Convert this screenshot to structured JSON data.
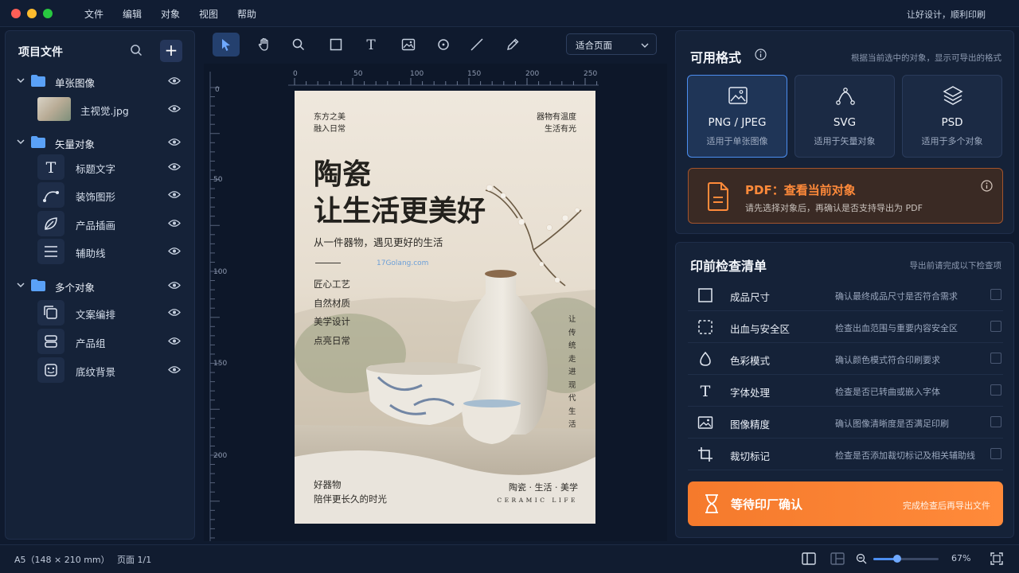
{
  "menubar": {
    "items": [
      "文件",
      "编辑",
      "对象",
      "视图",
      "帮助"
    ],
    "slogan": "让好设计，顺利印刷"
  },
  "left_panel": {
    "title": "项目文件",
    "groups": [
      {
        "label": "单张图像",
        "items": [
          {
            "label": "主视觉.jpg",
            "icon": "image-thumbnail"
          }
        ]
      },
      {
        "label": "矢量对象",
        "items": [
          {
            "label": "标题文字",
            "icon": "text-icon"
          },
          {
            "label": "装饰图形",
            "icon": "bezier-icon"
          },
          {
            "label": "产品插画",
            "icon": "leaf-icon"
          },
          {
            "label": "辅助线",
            "icon": "lines-icon"
          }
        ]
      },
      {
        "label": "多个对象",
        "items": [
          {
            "label": "文案编排",
            "icon": "copy-icon"
          },
          {
            "label": "产品组",
            "icon": "layers-group-icon"
          },
          {
            "label": "底纹背景",
            "icon": "pattern-icon"
          }
        ]
      }
    ]
  },
  "toolbar": {
    "tools": [
      "select-tool",
      "hand-tool",
      "zoom-tool",
      "rectangle-tool",
      "text-tool",
      "image-tool",
      "ellipse-tool",
      "line-tool",
      "pen-tool"
    ],
    "fit_label": "适合页面"
  },
  "rulers": {
    "top": [
      "0",
      "50",
      "100",
      "150",
      "200",
      "250"
    ],
    "left": [
      "0",
      "50",
      "100",
      "150",
      "200"
    ]
  },
  "poster": {
    "top_left_1": "东方之美",
    "top_left_2": "融入日常",
    "top_right_1": "器物有温度",
    "top_right_2": "生活有光",
    "headline_1": "陶瓷",
    "headline_2": "让生活更美好",
    "subtitle": "从一件器物，遇见更好的生活",
    "features": [
      "匠心工艺",
      "自然材质",
      "美学设计",
      "点亮日常"
    ],
    "vertical": "让传统走进现代生活",
    "bottom_left_1": "好器物",
    "bottom_left_2": "陪伴更长久的时光",
    "bottom_right_cn": "陶瓷 · 生活 · 美学",
    "bottom_right_en": "CERAMIC LIFE",
    "watermark": "17Golang.com"
  },
  "formats": {
    "title": "可用格式",
    "hint": "根据当前选中的对象，显示可导出的格式",
    "cards": [
      {
        "name": "PNG / JPEG",
        "desc": "适用于单张图像",
        "icon": "image-icon",
        "selected": true
      },
      {
        "name": "SVG",
        "desc": "适用于矢量对象",
        "icon": "vector-path-icon",
        "selected": false
      },
      {
        "name": "PSD",
        "desc": "适用于多个对象",
        "icon": "layers-icon",
        "selected": false
      }
    ],
    "pdf": {
      "title": "PDF：查看当前对象",
      "desc": "请先选择对象后，再确认是否支持导出为 PDF"
    }
  },
  "checklist": {
    "title": "印前检查清单",
    "hint": "导出前请完成以下检查项",
    "items": [
      {
        "label": "成品尺寸",
        "desc": "确认最终成品尺寸是否符合需求",
        "icon": "square-icon"
      },
      {
        "label": "出血与安全区",
        "desc": "检查出血范围与重要内容安全区",
        "icon": "dashed-square-icon"
      },
      {
        "label": "色彩模式",
        "desc": "确认颜色模式符合印刷要求",
        "icon": "droplet-icon"
      },
      {
        "label": "字体处理",
        "desc": "检查是否已转曲或嵌入字体",
        "icon": "type-icon"
      },
      {
        "label": "图像精度",
        "desc": "确认图像清晰度是否满足印刷",
        "icon": "picture-icon"
      },
      {
        "label": "裁切标记",
        "desc": "检查是否添加裁切标记及相关辅助线",
        "icon": "crop-icon"
      }
    ],
    "confirm": {
      "label": "等待印厂确认",
      "hint": "完成检查后再导出文件"
    }
  },
  "statusbar": {
    "page_size": "A5（148 × 210 mm）",
    "page_num": "页面  1/1",
    "zoom": "67%",
    "zoom_level": 0.67
  },
  "colors": {
    "accent": "#4c8ef0",
    "orange": "#f57a2c",
    "bg": "#0f1a2e"
  }
}
